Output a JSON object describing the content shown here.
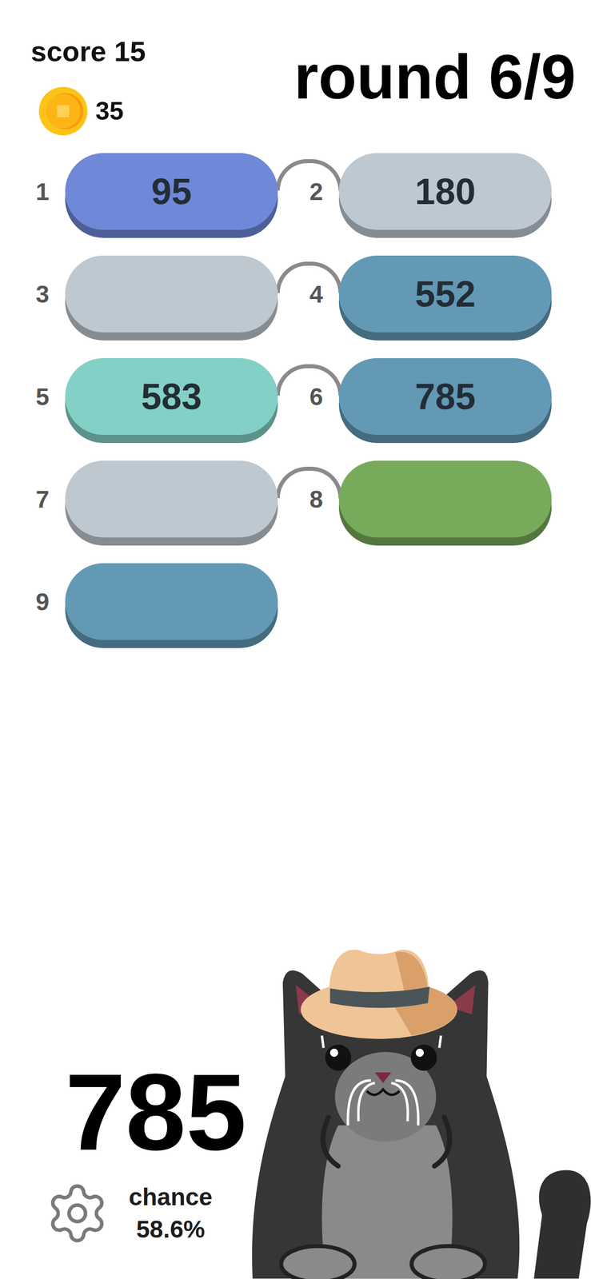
{
  "score": "score 15",
  "coins": "35",
  "round": "round 6/9",
  "slots": [
    {
      "number": "1",
      "value": "95",
      "color": "#7088d8"
    },
    {
      "number": "2",
      "value": "180",
      "color": "#bec8d0"
    },
    {
      "number": "3",
      "value": "",
      "color": "#bec8d0"
    },
    {
      "number": "4",
      "value": "552",
      "color": "#6399b5"
    },
    {
      "number": "5",
      "value": "583",
      "color": "#83d0c6"
    },
    {
      "number": "6",
      "value": "785",
      "color": "#6399b5"
    },
    {
      "number": "7",
      "value": "",
      "color": "#bec8d0"
    },
    {
      "number": "8",
      "value": "",
      "color": "#78aa5c"
    },
    {
      "number": "9",
      "value": "",
      "color": "#6399b5"
    }
  ],
  "current": "785",
  "chance": {
    "label": "chance",
    "value": "58.6%"
  }
}
